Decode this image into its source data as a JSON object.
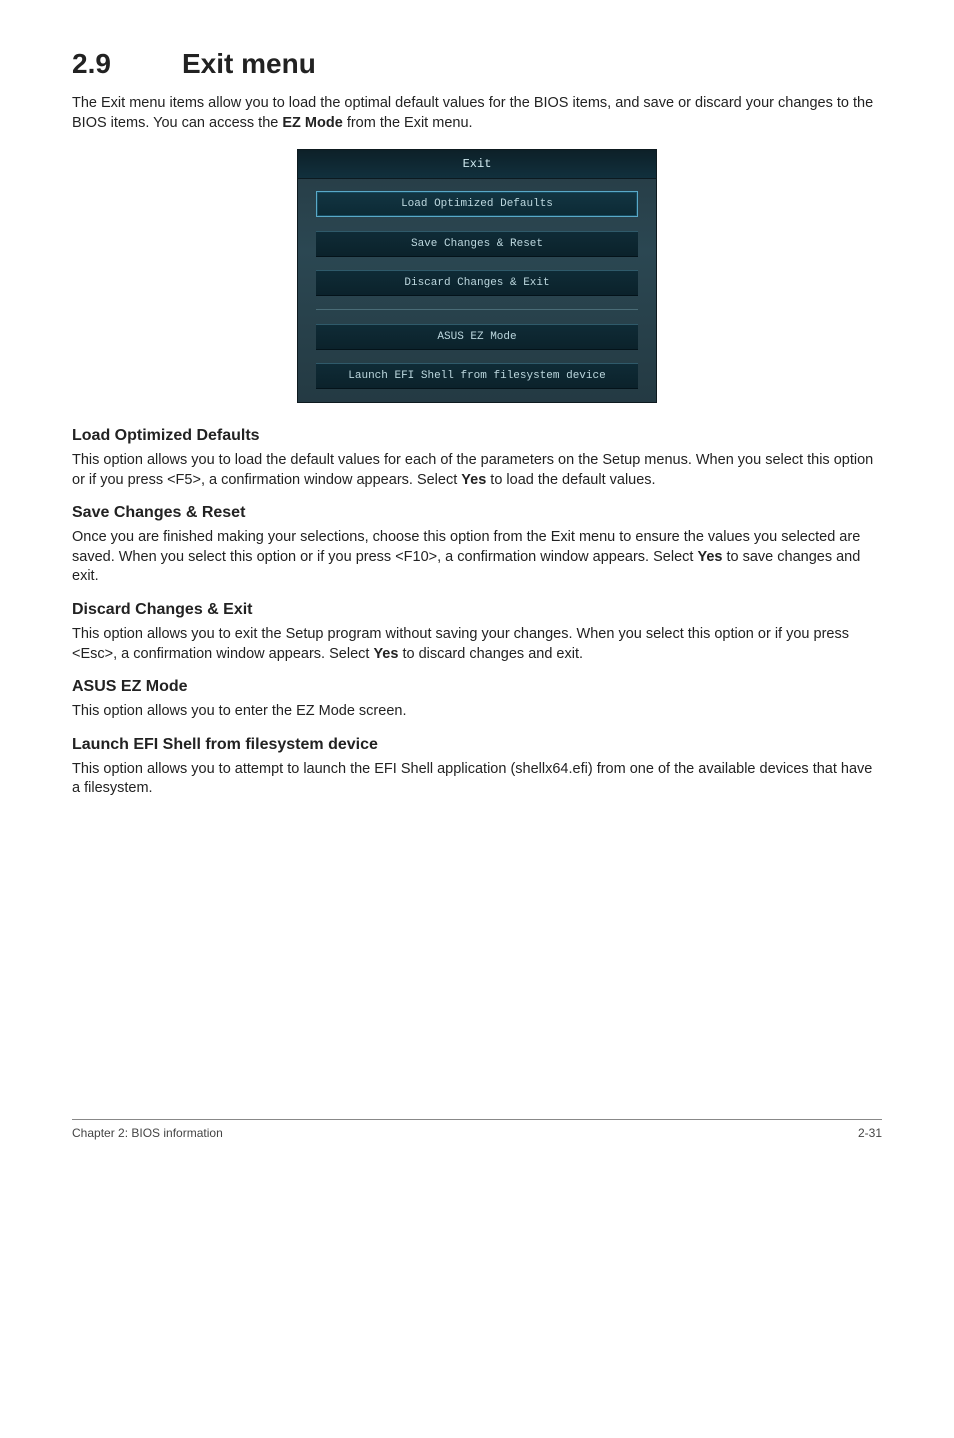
{
  "section": {
    "number": "2.9",
    "title": "Exit menu"
  },
  "intro": {
    "pre": "The Exit menu items allow you to load the optimal default values for the BIOS items, and save or discard your changes to the BIOS items. You can access the ",
    "bold": "EZ Mode",
    "post": " from the Exit menu."
  },
  "panel": {
    "header": "Exit",
    "btn_load": "Load Optimized Defaults",
    "btn_save": "Save Changes & Reset",
    "btn_discard": "Discard Changes & Exit",
    "btn_ez": "ASUS EZ Mode",
    "btn_shell": "Launch EFI Shell from filesystem device"
  },
  "sections": {
    "load": {
      "title": "Load Optimized Defaults",
      "pre": "This option allows you to load the default values for each of the parameters on the Setup menus. When you select this option or if you press <F5>, a confirmation window appears. Select ",
      "bold": "Yes",
      "post": " to load the default values."
    },
    "save": {
      "title": "Save Changes & Reset",
      "pre": "Once you are finished making your selections, choose this option from the Exit menu to ensure the values you selected are saved. When you select this option or if you press <F10>, a confirmation window appears. Select ",
      "bold": "Yes",
      "post": " to save changes and exit."
    },
    "discard": {
      "title": "Discard Changes & Exit",
      "pre": "This option allows you to exit the Setup program without saving your changes. When you select this option or if you press <Esc>, a confirmation window appears. Select ",
      "bold": "Yes",
      "post": " to discard changes and exit."
    },
    "ez": {
      "title": "ASUS EZ Mode",
      "text": "This option allows you to enter the EZ Mode screen."
    },
    "shell": {
      "title": "Launch EFI Shell from filesystem device",
      "text": "This option allows you to attempt to launch the EFI Shell application (shellx64.efi) from one of the available devices that have a filesystem."
    }
  },
  "footer": {
    "left": "Chapter 2: BIOS information",
    "right": "2-31"
  }
}
